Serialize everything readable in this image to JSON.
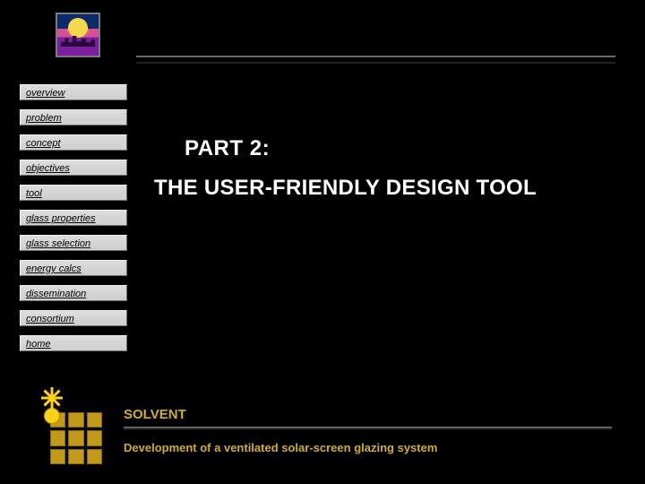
{
  "nav": {
    "items": [
      {
        "label": "overview"
      },
      {
        "label": "problem"
      },
      {
        "label": "concept"
      },
      {
        "label": "objectives"
      },
      {
        "label": "tool"
      },
      {
        "label": "glass properties"
      },
      {
        "label": "glass selection"
      },
      {
        "label": "energy calcs"
      },
      {
        "label": "dissemination"
      },
      {
        "label": "consortium"
      },
      {
        "label": "home"
      }
    ]
  },
  "title": {
    "line1": "PART 2:",
    "line2": "THE USER-FRIENDLY DESIGN TOOL"
  },
  "footer": {
    "brand": "SOLVENT",
    "tagline": "Development of a ventilated solar-screen glazing system"
  }
}
